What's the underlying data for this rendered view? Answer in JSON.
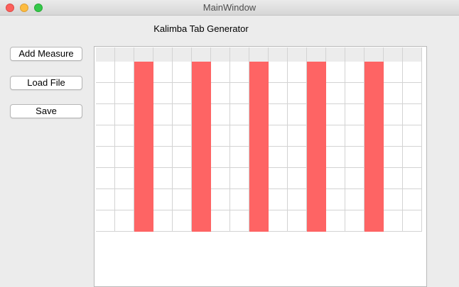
{
  "window": {
    "title": "MainWindow"
  },
  "app": {
    "title": "Kalimba Tab Generator"
  },
  "toolbar": {
    "add_measure_label": "Add Measure",
    "load_file_label": "Load File",
    "save_label": "Save"
  },
  "grid": {
    "columns": 17,
    "rows": 8,
    "header_row": true,
    "active_columns": [
      2,
      5,
      8,
      11,
      14
    ],
    "colors": {
      "active": "#fe6464",
      "cell": "#ffffff",
      "header": "#ececec",
      "gridline": "#d3d3d3"
    }
  }
}
